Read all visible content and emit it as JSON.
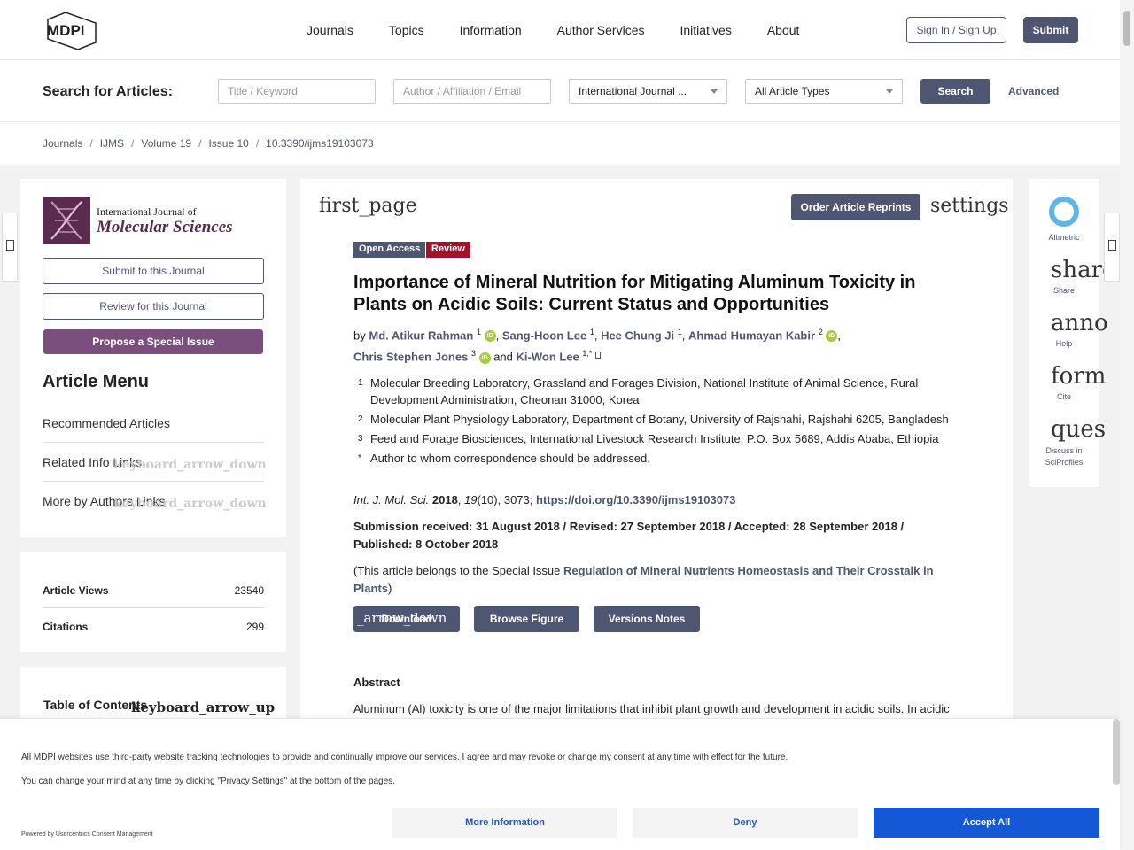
{
  "header": {
    "logo_text": "MDPI",
    "nav": [
      "Journals",
      "Topics",
      "Information",
      "Author Services",
      "Initiatives",
      "About"
    ],
    "signin": "Sign In / Sign Up",
    "submit": "Submit"
  },
  "search": {
    "label": "Search for Articles:",
    "title_placeholder": "Title / Keyword",
    "author_placeholder": "Author / Affiliation / Email",
    "journal_select": "International Journal ...",
    "type_select": "All Article Types",
    "search_btn": "Search",
    "advanced": "Advanced"
  },
  "breadcrumb": [
    "Journals",
    "IJMS",
    "Volume 19",
    "Issue 10",
    "10.3390/ijms19103073"
  ],
  "sidebar": {
    "journal_line1": "International Journal of",
    "journal_line2": "Molecular Sciences",
    "submit_btn": "Submit to this Journal",
    "review_btn": "Review for this Journal",
    "propose_btn": "Propose a Special Issue",
    "menu_title": "Article Menu",
    "menu_items": [
      "Recommended Articles",
      "Related Info Links",
      "More by Authors Links"
    ],
    "arrow_down": "keyboard_arrow_down",
    "views_label": "Article Views",
    "views_value": "23540",
    "citations_label": "Citations",
    "citations_value": "299",
    "toc_title": "Table of Contents",
    "arrow_up": "keyboard_arrow_up"
  },
  "article": {
    "first_page": "first_page",
    "settings": "settings",
    "reprints_btn": "Order Article Reprints",
    "badge_open": "Open Access",
    "badge_review": "Review",
    "title": "Importance of Mineral Nutrition for Mitigating Aluminum Toxicity in Plants on Acidic Soils: Current Status and Opportunities",
    "by": "by",
    "authors": [
      {
        "name": "Md. Atikur Rahman",
        "sup": "1"
      },
      {
        "name": "Sang-Hoon Lee",
        "sup": "1"
      },
      {
        "name": "Hee Chung Ji",
        "sup": "1"
      },
      {
        "name": "Ahmad Humayan Kabir",
        "sup": "2"
      },
      {
        "name": "Chris Stephen Jones",
        "sup": "3"
      },
      {
        "name": "Ki-Won Lee",
        "sup": "1,*"
      }
    ],
    "and": "and",
    "orcid": "iD",
    "affiliations": [
      {
        "n": "1",
        "text": "Molecular Breeding Laboratory, Grassland and Forages Division, National Institute of Animal Science, Rural Development Administration, Cheonan 31000, Korea"
      },
      {
        "n": "2",
        "text": "Molecular Plant Physiology Laboratory, Department of Botany, University of Rajshahi, Rajshahi 6205, Bangladesh"
      },
      {
        "n": "3",
        "text": "Feed and Forage Biosciences, International Livestock Research Institute, P.O. Box 5689, Addis Ababa, Ethiopia"
      },
      {
        "n": "*",
        "text": "Author to whom correspondence should be addressed."
      }
    ],
    "journal_abbr": "Int. J. Mol. Sci.",
    "year": "2018",
    "volume": "19",
    "issue_pages": "(10), 3073;",
    "doi": "https://doi.org/10.3390/ijms19103073",
    "dates": "Submission received: 31 August 2018 / Revised: 27 September 2018 / Accepted: 28 September 2018 / Published: 8 October 2018",
    "special_prefix": "(This article belongs to the Special Issue",
    "special_link": "Regulation of Mineral Nutrients Homeostasis and Their Crosstalk in Plants",
    "special_suffix": ")",
    "download_btn": "Download",
    "download_ligature": "_arrow_down",
    "browse_btn": "Browse Figure",
    "versions_btn": "Versions Notes",
    "abstract_title": "Abstract",
    "abstract_text": "Aluminum (Al) toxicity is one of the major limitations that inhibit plant growth and development in acidic soils. In acidic"
  },
  "rail": {
    "altmetric": "Altmetric",
    "share_lig": "share",
    "share": "Share",
    "help_lig": "announcement",
    "help": "Help",
    "cite_lig": "format_quote",
    "cite": "Cite",
    "discuss_lig": "question_answer",
    "discuss": "Discuss in SciProfiles"
  },
  "consent": {
    "line1": "All MDPI websites use third-party website tracking technologies to provide and continually improve our services. I agree and may revoke or change my consent at any time with effect for the future.",
    "line2": "You can change your mind at any time by clicking \"Privacy Settings\" at the bottom of the pages.",
    "powered": "Powered by Usercentrics Consent Management",
    "more": "More Information",
    "deny": "Deny",
    "accept": "Accept All"
  }
}
